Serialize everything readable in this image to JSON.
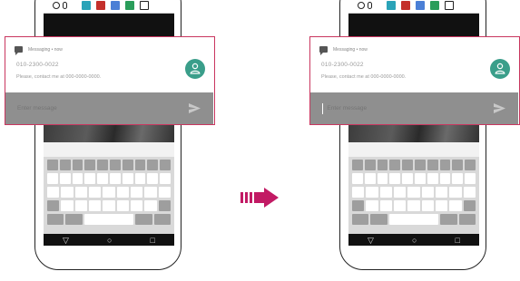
{
  "notification": {
    "app_line": "Messaging • now",
    "sender": "010-2300-0022",
    "message": "Please, contact me at 000-0000-0000.",
    "reply_placeholder": "Enter message"
  },
  "colors": {
    "highlight_border": "#c9365f",
    "avatar": "#3a9e8a",
    "reply_bar": "#8f8f8f",
    "arrow": "#c21a64"
  },
  "icons": {
    "notification_app": "chat-bubble-icon",
    "avatar": "person-icon",
    "send": "send-icon",
    "transition": "right-arrow-icon"
  }
}
